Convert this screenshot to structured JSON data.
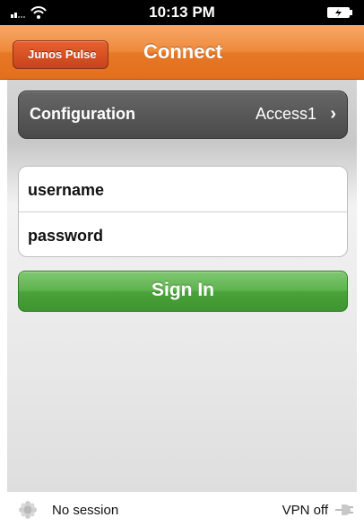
{
  "status_bar": {
    "time": "10:13 PM",
    "icons": [
      "signal-icon",
      "wifi-icon",
      "battery-icon"
    ]
  },
  "nav": {
    "back_label": "Junos Pulse",
    "title": "Connect"
  },
  "config": {
    "label": "Configuration",
    "value": "Access1",
    "chevron": "›"
  },
  "form": {
    "username_placeholder": "username",
    "password_placeholder": "password"
  },
  "sign_in": {
    "label": "Sign In"
  },
  "footer": {
    "session_label": "No session",
    "vpn_label": "VPN off"
  },
  "colors": {
    "nav_accent": "#e67826",
    "back_button": "#c8431b",
    "sign_in": "#4aa23a",
    "config_row": "#4a4a4a"
  }
}
